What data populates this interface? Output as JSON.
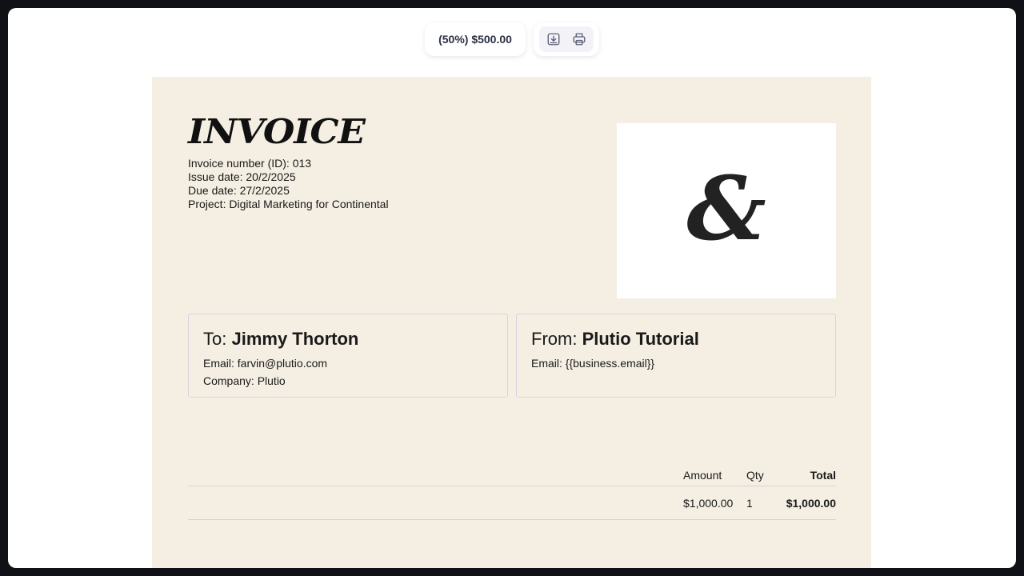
{
  "toolbar": {
    "payment_label": "(50%) $500.00",
    "download_icon": "download-icon",
    "print_icon": "printer-icon"
  },
  "invoice": {
    "title": "INVOICE",
    "number_line": "Invoice number (ID): 013",
    "issue_line": "Issue date: 20/2/2025",
    "due_line": "Due date: 27/2/2025",
    "project_line": "Project: Digital Marketing for Continental",
    "logo_glyph": "&",
    "background_color": "#f5efe3"
  },
  "to": {
    "prefix": "To: ",
    "name": "Jimmy Thorton",
    "email_line": "Email: farvin@plutio.com",
    "company_line": "Company: Plutio"
  },
  "from": {
    "prefix": "From: ",
    "name": "Plutio Tutorial",
    "email_line": "Email: {{business.email}}"
  },
  "items": {
    "headers": {
      "amount": "Amount",
      "qty": "Qty",
      "total": "Total"
    },
    "rows": [
      {
        "amount": "$1,000.00",
        "qty": "1",
        "total": "$1,000.00"
      }
    ]
  }
}
